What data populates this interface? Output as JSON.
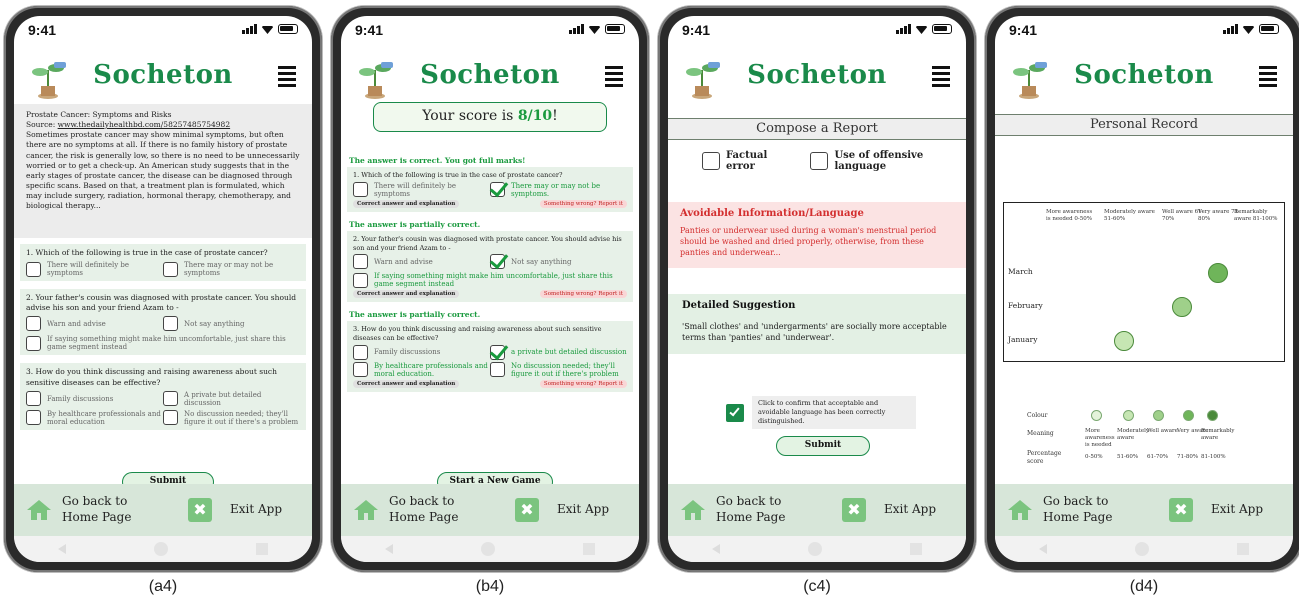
{
  "common": {
    "time": "9:41",
    "brand": "Socheton",
    "home_label": "Go back to Home Page",
    "home_line1": "Go back to",
    "home_line2": "Home Page",
    "exit_label": "Exit App",
    "submit": "Submit",
    "correct_expl": "Correct answer and explanation",
    "something_wrong": "Something wrong? Report it",
    "colors": {
      "brand": "#1a8a4a",
      "accent": "#1a9a3e",
      "nav_bg": "#d7e6d9",
      "question_bg": "#e7f1e8"
    }
  },
  "captions": [
    "(a4)",
    "(b4)",
    "(c4)",
    "(d4)"
  ],
  "a4": {
    "article_title": "Prostate Cancer: Symptoms and Risks",
    "source_label": "Source: ",
    "source_url": "www.thedailyhealthbd.com/58257485754982",
    "body": "Sometimes prostate cancer may show minimal symptoms, but often there are no symptoms at all. If there is no family history of prostate cancer, the risk is generally low, so there is no need to be unnecessarily worried or to get a check-up. An American study suggests that in the early stages of prostate cancer, the disease can be diagnosed through specific scans. Based on that, a treatment plan is formulated, which may include surgery, radiation, hormonal therapy, chemotherapy, and biological therapy...",
    "q1": "1. Which of the following is true in the case of prostate cancer?",
    "q1_opt1": "There will definitely be symptoms",
    "q1_opt2": "There may or may not be symptoms",
    "q2": "2. Your father's cousin was diagnosed with prostate cancer. You should advise his son and your friend Azam to -",
    "q2_opt1": "Warn and advise",
    "q2_opt2": "Not say anything",
    "q2_opt3": "If saying something might make him uncomfortable, just share this game segment instead",
    "q3": "3. How do you think discussing and raising awareness about such sensitive diseases can be effective?",
    "q3_opt1": "Family discussions",
    "q3_opt2": "A private but detailed discussion",
    "q3_opt3": "By healthcare professionals and moral education",
    "q3_opt4": "No discussion needed; they'll figure it out if there's a problem"
  },
  "b4": {
    "score_prefix": "Your score is ",
    "score": "8/10",
    "score_suffix": "!",
    "r1": "The answer is correct. You got full marks!",
    "q1": "1. Which of the following is true in the case of prostate cancer?",
    "q1_opt1": "There will definitely be symptoms",
    "q1_opt2": "There may or may not be symptoms.",
    "r2": "The answer is partially correct.",
    "q2": "2. Your father's cousin was diagnosed with prostate cancer. You should advise his son and your friend Azam to -",
    "q2_opt1": "Warn and advise",
    "q2_opt2": "Not say anything",
    "q2_opt3": "If saying something might make him uncomfortable, just share this game segment instead",
    "r3": "The answer is partially correct.",
    "q3": "3. How do you think discussing and raising awareness about such sensitive diseases can be effective?",
    "q3_opt1": "Family discussions",
    "q3_opt2": "a private but detailed discussion",
    "q3_opt3": "By healthcare professionals and moral education.",
    "q3_opt4": "No discussion needed; they'll figure it out if there's problem",
    "new_game": "Start a New Game"
  },
  "c4": {
    "title": "Compose a Report",
    "factual": "Factual error",
    "offensive": "Use of offensive language",
    "avoid_heading": "Avoidable Information/Language",
    "avoid_text": "Panties or underwear used during a woman's menstrual period should be washed and dried properly, otherwise, from these panties and underwear...",
    "sugg_heading": "Detailed Suggestion",
    "sugg_text": "'Small clothes' and 'undergarments' are socially more acceptable terms than 'panties' and 'underwear'.",
    "confirm": "Click to confirm that acceptable and avoidable language has been correctly distinguished."
  },
  "d4": {
    "title": "Personal Record",
    "columns": [
      {
        "name": "More awareness is needed",
        "range": "0-50%"
      },
      {
        "name": "Moderately aware",
        "range": "51-60%"
      },
      {
        "name": "Well aware",
        "range": "61-70%"
      },
      {
        "name": "Very aware",
        "range": "71-80%"
      },
      {
        "name": "Remarkably aware",
        "range": "81-100%"
      }
    ],
    "rows": [
      {
        "month": "March",
        "level": 3
      },
      {
        "month": "February",
        "level": 2
      },
      {
        "month": "January",
        "level": 1
      }
    ],
    "legend_colour": "Colour",
    "legend_meaning": "Meaning",
    "legend_percentage": "Percentage score",
    "legend_colors": [
      "#e4f3da",
      "#c6e6b3",
      "#9fd08a",
      "#6fb55a",
      "#4a8a3a"
    ],
    "legend_items": [
      {
        "meaning": "More awareness is needed",
        "range": "0-50%"
      },
      {
        "meaning": "Moderately aware",
        "range": "51-60%"
      },
      {
        "meaning": "Well aware",
        "range": "61-70%"
      },
      {
        "meaning": "Very aware",
        "range": "71-80%"
      },
      {
        "meaning": "Remarkably aware",
        "range": "81-100%"
      }
    ]
  }
}
